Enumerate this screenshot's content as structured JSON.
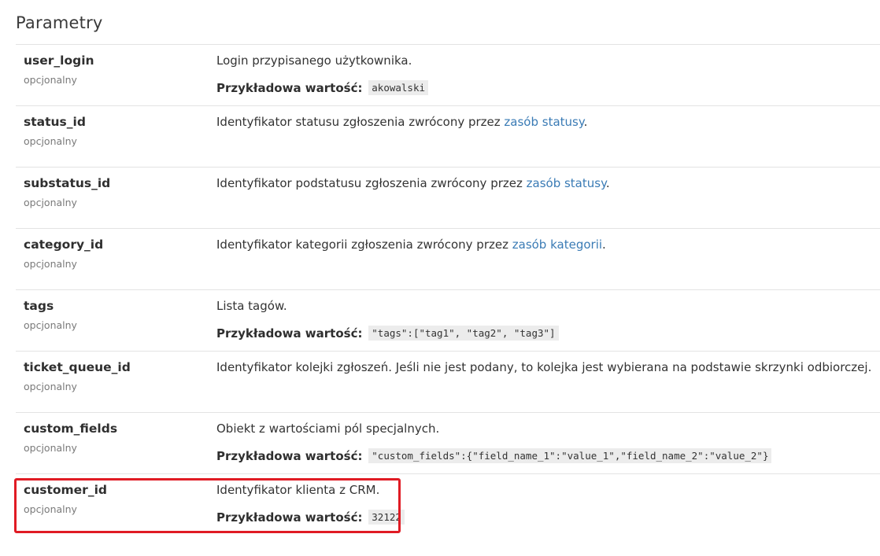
{
  "section_title": "Parametry",
  "example_label": "Przykładowa wartość:",
  "params": [
    {
      "name": "user_login",
      "optional": "opcjonalny",
      "desc_before": "Login przypisanego użytkownika.",
      "link": "",
      "desc_after": "",
      "example": "akowalski"
    },
    {
      "name": "status_id",
      "optional": "opcjonalny",
      "desc_before": "Identyfikator statusu zgłoszenia zwrócony przez ",
      "link": "zasób statusy",
      "desc_after": ".",
      "example": ""
    },
    {
      "name": "substatus_id",
      "optional": "opcjonalny",
      "desc_before": "Identyfikator podstatusu zgłoszenia zwrócony przez ",
      "link": "zasób statusy",
      "desc_after": ".",
      "example": ""
    },
    {
      "name": "category_id",
      "optional": "opcjonalny",
      "desc_before": "Identyfikator kategorii zgłoszenia zwrócony przez ",
      "link": "zasób kategorii",
      "desc_after": ".",
      "example": ""
    },
    {
      "name": "tags",
      "optional": "opcjonalny",
      "desc_before": "Lista tagów.",
      "link": "",
      "desc_after": "",
      "example": "\"tags\":[\"tag1\", \"tag2\", \"tag3\"]"
    },
    {
      "name": "ticket_queue_id",
      "optional": "opcjonalny",
      "desc_before": "Identyfikator kolejki zgłoszeń. Jeśli nie jest podany, to kolejka jest wybierana na podstawie skrzynki odbiorczej.",
      "link": "",
      "desc_after": "",
      "example": ""
    },
    {
      "name": "custom_fields",
      "optional": "opcjonalny",
      "desc_before": "Obiekt z wartościami pól specjalnych.",
      "link": "",
      "desc_after": "",
      "example": "\"custom_fields\":{\"field_name_1\":\"value_1\",\"field_name_2\":\"value_2\"}"
    },
    {
      "name": "customer_id",
      "optional": "opcjonalny",
      "desc_before": "Identyfikator klienta z CRM.",
      "link": "",
      "desc_after": "",
      "example": "32122"
    }
  ],
  "highlight_color": "#e01b24",
  "link_color": "#3a7bb5"
}
